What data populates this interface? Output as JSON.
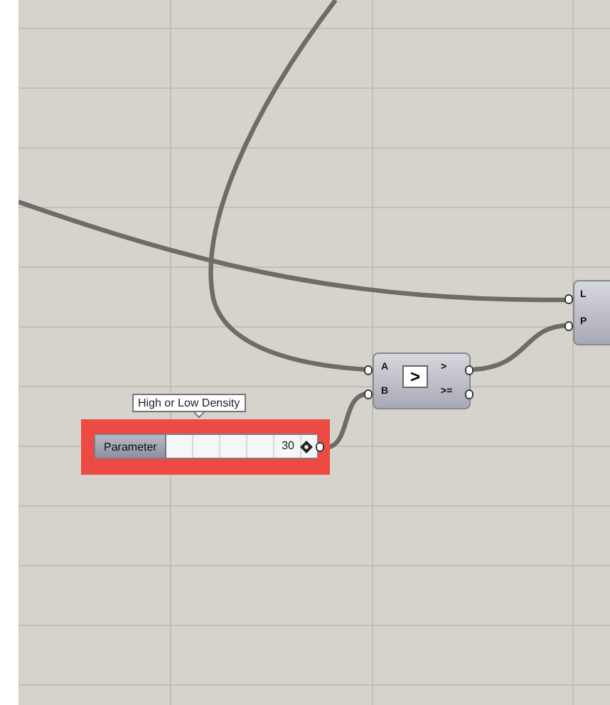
{
  "tooltip": "High or Low Density",
  "slider": {
    "label": "Parameter",
    "value": "30",
    "level": 0.92,
    "highlighted": true
  },
  "compare_node": {
    "inputs": [
      "A",
      "B"
    ],
    "symbol": ">",
    "outputs": [
      ">",
      ">="
    ]
  },
  "right_node": {
    "inputs": [
      "L",
      "P"
    ]
  }
}
